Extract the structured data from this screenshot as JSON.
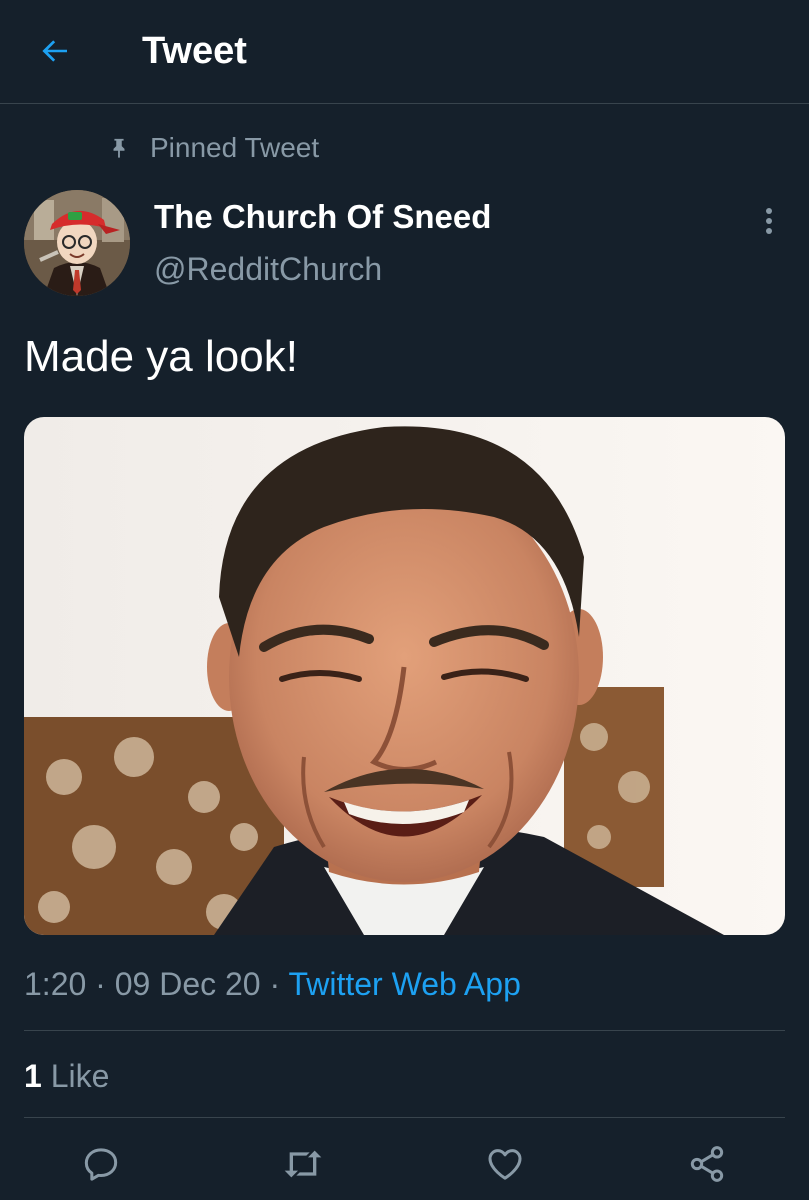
{
  "header": {
    "title": "Tweet",
    "back_icon": "arrow-left-icon",
    "accent": "#1da1f2"
  },
  "pinned": {
    "label": "Pinned Tweet",
    "icon": "pin-icon"
  },
  "author": {
    "display_name": "The Church Of Sneed",
    "handle": "@RedditChurch",
    "avatar": "cartoon-avatar"
  },
  "tweet": {
    "text": "Made ya look!",
    "media": "photo-smiling-man-in-suit"
  },
  "meta": {
    "time": "1:20",
    "separator1": " · ",
    "date": "09 Dec 20",
    "separator2": " · ",
    "source": "Twitter Web App"
  },
  "stats": {
    "likes_count": "1",
    "likes_label": "Like"
  },
  "actions": {
    "reply": "reply-icon",
    "retweet": "retweet-icon",
    "like": "heart-icon",
    "share": "share-icon"
  },
  "colors": {
    "background": "#15202b",
    "border": "#38444d",
    "secondary_text": "#8899a6",
    "link": "#1da1f2"
  }
}
